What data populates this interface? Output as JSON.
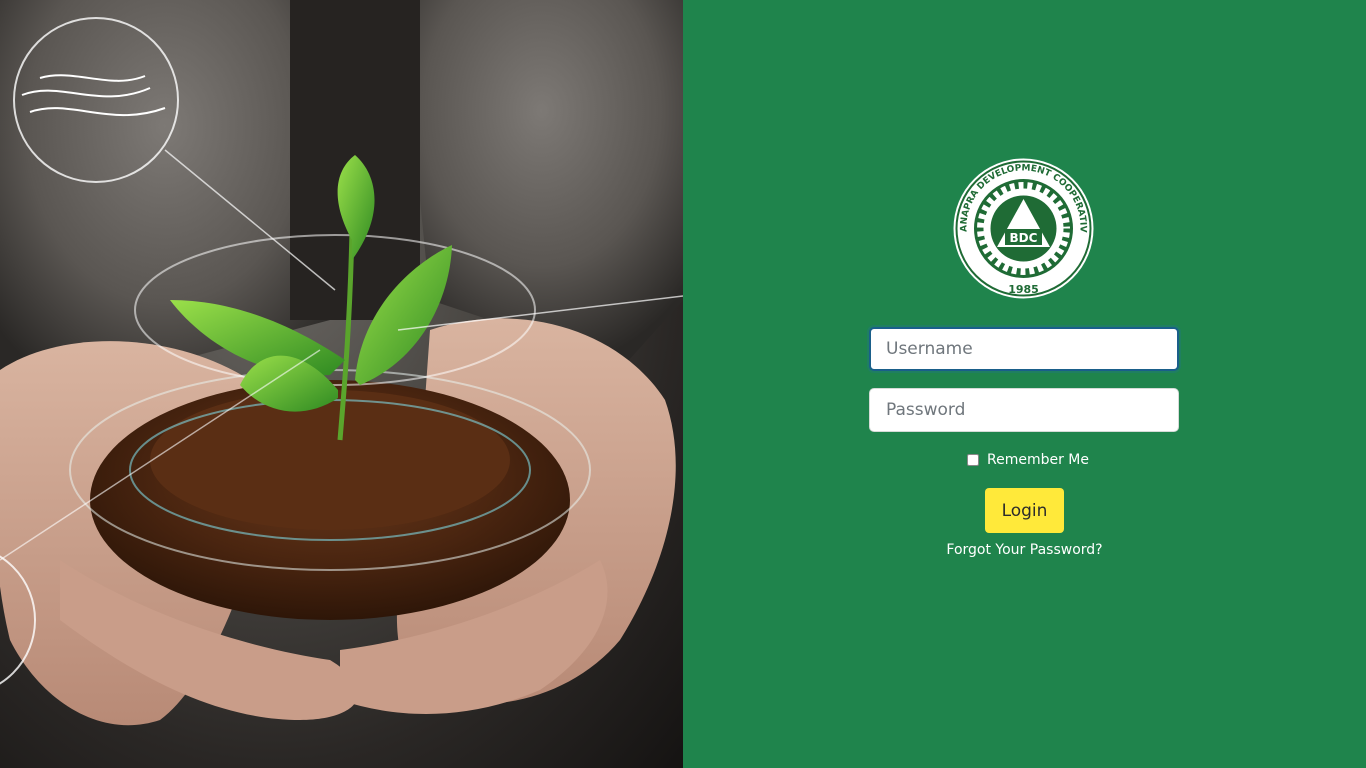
{
  "hero": {
    "image_icon": "hands-holding-soil-seedling-image"
  },
  "logo": {
    "ring_text": "BANAPRA DEVELOPMENT COOPERATIVE",
    "center_text": "BDC",
    "year": "1985",
    "ring_color": "#ffffff",
    "emblem_color": "#1f6b35"
  },
  "form": {
    "username_placeholder": "Username",
    "password_placeholder": "Password",
    "remember_label": "Remember Me",
    "remember_checked": false,
    "login_label": "Login",
    "forgot_label": "Forgot Your Password?"
  },
  "colors": {
    "panel_green": "#1f844c",
    "button_yellow": "#ffe93a"
  }
}
